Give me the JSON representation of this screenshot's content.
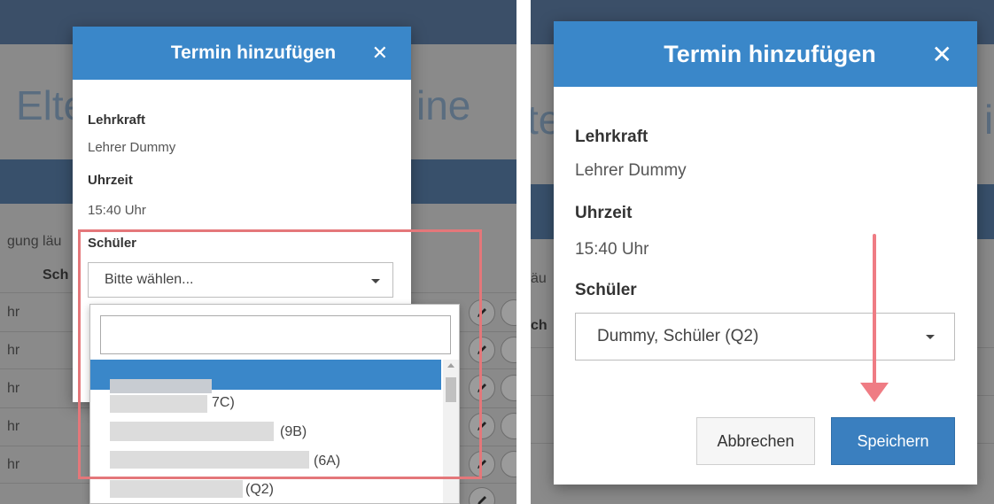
{
  "left_panel": {
    "background_page": {
      "heading_left": "Elte",
      "heading_right": "ine",
      "text_fragment": "gung läu",
      "column_fragment": "Sch",
      "row_fragments": [
        "hr",
        "hr",
        "hr",
        "hr",
        "hr"
      ]
    },
    "modal": {
      "title": "Termin hinzufügen",
      "close_glyph": "✕",
      "teacher_label": "Lehrkraft",
      "teacher_value": "Lehrer Dummy",
      "time_label": "Uhrzeit",
      "time_value": "15:40 Uhr",
      "student_label": "Schüler",
      "student_select_value": "Bitte wählen..."
    },
    "dropdown": {
      "search_value": "",
      "items": [
        "7C)",
        "(9B)",
        "(6A)",
        "(Q2)"
      ]
    }
  },
  "right_panel": {
    "background_page": {
      "heading_left": "te",
      "heading_right": "i",
      "text_fragment": "äu",
      "column_fragment": "ch"
    },
    "modal": {
      "title": "Termin hinzufügen",
      "close_glyph": "✕",
      "teacher_label": "Lehrkraft",
      "teacher_value": "Lehrer Dummy",
      "time_label": "Uhrzeit",
      "time_value": "15:40 Uhr",
      "student_label": "Schüler",
      "student_select_value": "Dummy, Schüler (Q2)",
      "cancel_label": "Abbrechen",
      "save_label": "Speichern"
    }
  },
  "colors": {
    "header_blue": "#3a87c9",
    "primary_button": "#3a7fbf",
    "highlight_red": "#e4777a",
    "overlay_gray": "#8a8a8a"
  }
}
